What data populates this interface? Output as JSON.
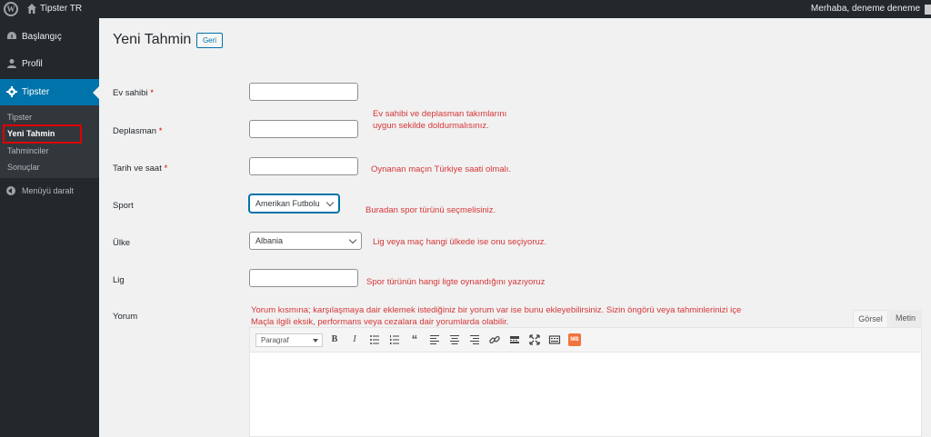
{
  "adminbar": {
    "site_name": "Tipster TR",
    "greeting": "Merhaba, deneme deneme"
  },
  "sidebar": {
    "menu": [
      {
        "label": "Başlangıç",
        "icon": "dashboard-icon"
      },
      {
        "label": "Profil",
        "icon": "user-icon"
      },
      {
        "label": "Tipster",
        "icon": "gear-icon"
      }
    ],
    "submenu": [
      {
        "label": "Tipster"
      },
      {
        "label": "Yeni Tahmin"
      },
      {
        "label": "Tahminciler"
      },
      {
        "label": "Sonuçlar"
      }
    ],
    "collapse_label": "Menüyü daralt"
  },
  "page": {
    "title": "Yeni Tahmin",
    "back_button": "Geri"
  },
  "form": {
    "home_label": "Ev sahibi",
    "away_label": "Deplasman",
    "datetime_label": "Tarih ve saat",
    "sport_label": "Sport",
    "sport_value": "Amerikan Futbolu",
    "country_label": "Ülke",
    "country_value": "Albania",
    "league_label": "Lig",
    "comment_label": "Yorum",
    "required_mark": "*"
  },
  "notes": {
    "teams_line1": "Ev sahibi ve deplasman takımlarını",
    "teams_line2": "uygun sekilde doldurmalısınız.",
    "datetime": "Oynanan maçın Türkiye  saati olmalı.",
    "sport": "Buradan spor türünü seçmelisiniz.",
    "country": "Lig veya maç hangi ülkede ise onu seçiyoruz.",
    "league": "Spor türünün hangi ligte oynandığını yazıyoruz",
    "comment_line1": "Yorum kısmına; karşılaşmaya dair eklemek istediğiniz bir yorum var ise bunu ekleyebilirsiniz. Sizin öngörü veya tahminlerinizi içe",
    "comment_line2": "Maçla ilgili eksik, performans veya cezalara dair yorumlarda olabilir."
  },
  "editor": {
    "tab_visual": "Görsel",
    "tab_text": "Metin",
    "format_value": "Paragraf",
    "mb_label": "MB"
  },
  "colors": {
    "sidebar": "#23282d",
    "accent": "#0073aa",
    "note_red": "#d63638",
    "highlight_box": "#dd0000"
  }
}
